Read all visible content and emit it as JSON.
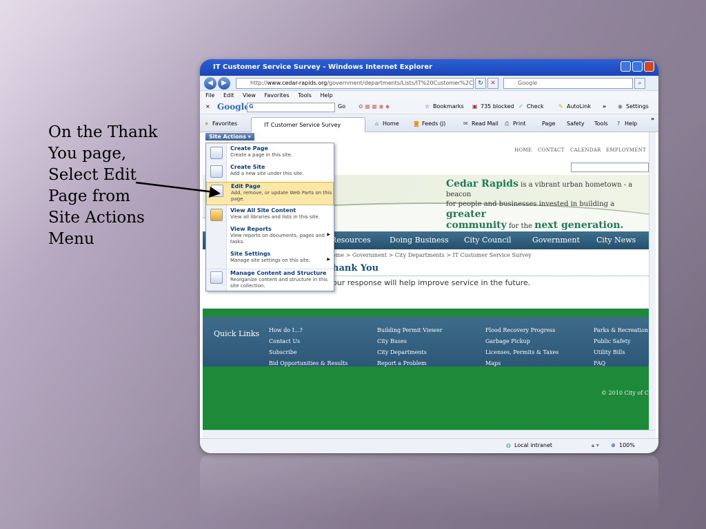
{
  "caption": {
    "lines": [
      "On the Thank",
      "You page,",
      "Select Edit",
      "Page from",
      "Site Actions",
      "Menu"
    ]
  },
  "window": {
    "title": "IT Customer Service Survey - Windows Internet Explorer"
  },
  "address": {
    "prefix": "http://",
    "host": "www.cedar-rapids.org",
    "path": "/government/departments/Lists/IT%20Customer%2C",
    "search_value": "Google"
  },
  "menubar": [
    "File",
    "Edit",
    "View",
    "Favorites",
    "Tools",
    "Help"
  ],
  "googlebar": {
    "close": "×",
    "logo": "Google",
    "box": "G",
    "go": "Go",
    "bookmarks": "Bookmarks",
    "blocked": "735 blocked",
    "check": "Check",
    "autolink": "AutoLink",
    "more": "»",
    "settings": "Settings"
  },
  "favbar": {
    "favorites": "Favorites",
    "tab": "IT Customer Service Survey",
    "home": "Home",
    "feeds": "Feeds (J)",
    "readmail": "Read Mail",
    "print": "Print",
    "page": "Page",
    "safety": "Safety",
    "tools": "Tools",
    "help": "Help",
    "more": "»"
  },
  "site": {
    "site_actions": "Site Actions",
    "top_nav": [
      "HOME",
      "CONTACT",
      "CALENDAR",
      "EMPLOYMENT"
    ],
    "tagline": {
      "name": "Cedar Rapids",
      "t1": " is a vibrant urban hometown - a beacon",
      "t2": "for people and businesses invested in building a ",
      "greater": "greater",
      "community": "community",
      "t3": " for the ",
      "next_gen": "next generation",
      "dot": "."
    },
    "main_nav": [
      "Resources",
      "Doing Business",
      "City Council",
      "Government",
      "City News"
    ],
    "breadcrumb": [
      "ome",
      "Government",
      "City Departments",
      "IT Customer Service Survey"
    ],
    "page_title": "hank You",
    "message": "our response will help improve service in the future.",
    "quick_links": {
      "label": "Quick Links",
      "col1": [
        "How do I...?",
        "Contact Us",
        "Subscribe",
        "Bid Opportunities & Results"
      ],
      "col2": [
        "Building Permit Viewer",
        "City Buses",
        "City Departments",
        "Report a Problem"
      ],
      "col3": [
        "Flood Recovery Progress",
        "Garbage Pickup",
        "Licenses, Permits & Taxes",
        "Maps"
      ],
      "col4": [
        "Parks & Recreation",
        "Public Safety",
        "Utility Bills",
        "FAQ"
      ]
    },
    "copyright": "© 2010 City of C"
  },
  "site_actions_menu": [
    {
      "title": "Create Page",
      "desc": "Create a page in this site."
    },
    {
      "title": "Create Site",
      "desc": "Add a new site under this site."
    },
    {
      "title": "Edit Page",
      "desc": "Add, remove, or update Web Parts on this page."
    },
    {
      "title": "View All Site Content",
      "desc": "View all libraries and lists in this site."
    },
    {
      "title": "View Reports",
      "desc": "View reports on documents, pages and tasks."
    },
    {
      "title": "Site Settings",
      "desc": "Manage site settings on this site."
    },
    {
      "title": "Manage Content and Structure",
      "desc": "Reorganize content and structure in this site collection."
    }
  ],
  "status": {
    "zone": "Local intranet",
    "zoom": "100%"
  },
  "colors": {
    "accent_green": "#1d8a3a",
    "nav_blue": "#2d5776",
    "highlight": "#fbe7a6"
  }
}
